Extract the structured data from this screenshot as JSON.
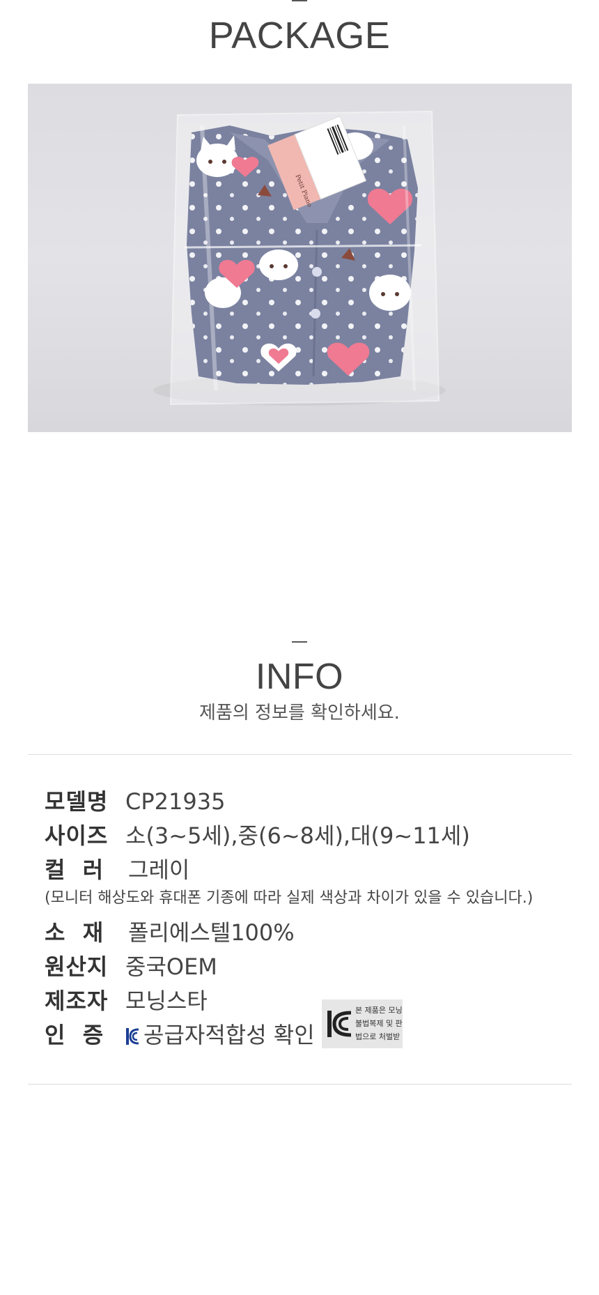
{
  "package": {
    "title": "PACKAGE",
    "photo_alt": "Packaged gray fleece pajamas with white cat and pink heart print in clear plastic bag",
    "tag_text": "Petit Piano"
  },
  "info": {
    "title": "INFO",
    "subtitle": "제품의 정보를 확인하세요."
  },
  "specs": [
    {
      "label": "모델명",
      "value": "CP21935"
    },
    {
      "label": "사이즈",
      "value": "소(3~5세),중(6~8세),대(9~11세)"
    },
    {
      "label": "컬  러",
      "value": "그레이"
    },
    {
      "label": "소  재",
      "value": "폴리에스텔100%"
    },
    {
      "label": "원산지",
      "value": "중국OEM"
    },
    {
      "label": "제조자",
      "value": "모닝스타"
    },
    {
      "label": "인  증",
      "value": "공급자적합성 확인"
    }
  ],
  "color_note": "(모니터 해상도와 휴대폰 기종에 따라 실제 색상과 차이가 있을 수 있습니다.)",
  "kc_badge": {
    "icon": "kc-mark-icon",
    "lines": [
      "본 제품은 모닝",
      "불법복제 및 판",
      "법으로 처벌받"
    ]
  },
  "colors": {
    "background": "#ffffff",
    "divider": "#dcdcdc",
    "photo_bg": "#e0e0e4",
    "fabric": "#7b82a0",
    "heart": "#ef7a92",
    "kc_blue": "#1c3f94"
  }
}
